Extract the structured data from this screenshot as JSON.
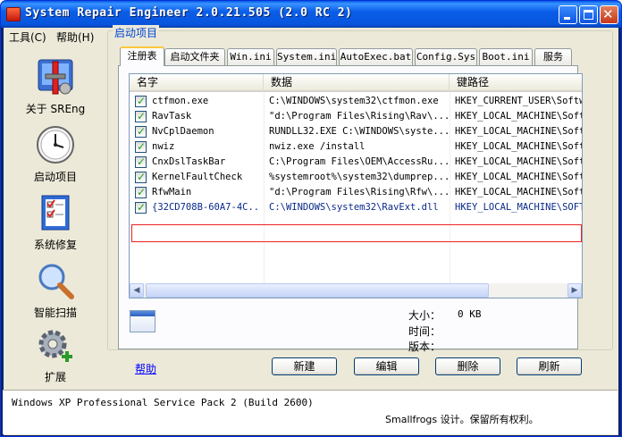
{
  "window": {
    "title": "System Repair Engineer 2.0.21.505 (2.0 RC 2)"
  },
  "menu": {
    "items": [
      "工具(C)",
      "帮助(H)"
    ]
  },
  "sidebar": {
    "items": [
      {
        "label": "关于 SREng",
        "icon": "toolbox-icon"
      },
      {
        "label": "启动项目",
        "icon": "clock-icon",
        "selected": true
      },
      {
        "label": "系统修复",
        "icon": "checklist-icon"
      },
      {
        "label": "智能扫描",
        "icon": "magnifier-icon"
      },
      {
        "label": "扩展",
        "icon": "gear-add-icon"
      }
    ]
  },
  "group": {
    "title": "启动项目"
  },
  "tabs": [
    "注册表",
    "启动文件夹",
    "Win.ini",
    "System.ini",
    "AutoExec.bat",
    "Config.Sys",
    "Boot.ini",
    "服务"
  ],
  "list": {
    "columns": [
      "名字",
      "数据",
      "键路径"
    ],
    "rows": [
      {
        "name": "ctfmon.exe",
        "data": "C:\\WINDOWS\\system32\\ctfmon.exe",
        "key": "HKEY_CURRENT_USER\\Softw",
        "checked": true
      },
      {
        "name": "RavTask",
        "data": "\"d:\\Program Files\\Rising\\Rav\\...",
        "key": "HKEY_LOCAL_MACHINE\\Softv",
        "checked": true
      },
      {
        "name": "NvCplDaemon",
        "data": "RUNDLL32.EXE C:\\WINDOWS\\syste...",
        "key": "HKEY_LOCAL_MACHINE\\Softv",
        "checked": true
      },
      {
        "name": "nwiz",
        "data": "nwiz.exe /install",
        "key": "HKEY_LOCAL_MACHINE\\Softv",
        "checked": true
      },
      {
        "name": "CnxDslTaskBar",
        "data": "C:\\Program Files\\OEM\\AccessRu...",
        "key": "HKEY_LOCAL_MACHINE\\Softv",
        "checked": true
      },
      {
        "name": "KernelFaultCheck",
        "data": "%systemroot%\\system32\\dumprep...",
        "key": "HKEY_LOCAL_MACHINE\\Softv",
        "checked": true
      },
      {
        "name": "RfwMain",
        "data": "\"d:\\Program Files\\Rising\\Rfw\\...",
        "key": "HKEY_LOCAL_MACHINE\\Softv",
        "checked": true
      },
      {
        "name": "{32CD708B-60A7-4C...",
        "data": "C:\\WINDOWS\\system32\\RavExt.dll",
        "key": "HKEY_LOCAL_MACHINE\\SOFTW",
        "checked": true,
        "highlighted": true
      }
    ]
  },
  "details": {
    "size_label": "大小：",
    "size_value": "0 KB",
    "time_label": "时间：",
    "time_value": "",
    "version_label": "版本：",
    "version_value": ""
  },
  "help_link": "帮助",
  "buttons": {
    "new": "新建",
    "edit": "编辑",
    "delete": "删除",
    "refresh": "刷新"
  },
  "status": {
    "os": "Windows XP Professional Service Pack 2 (Build 2600)",
    "credit": "Smallfrogs 设计。保留所有权利。"
  },
  "colors": {
    "titlebar": "#0a5ee8",
    "link": "#0000ff",
    "highlight_border": "#ee2222",
    "group_label": "#0046d5"
  }
}
